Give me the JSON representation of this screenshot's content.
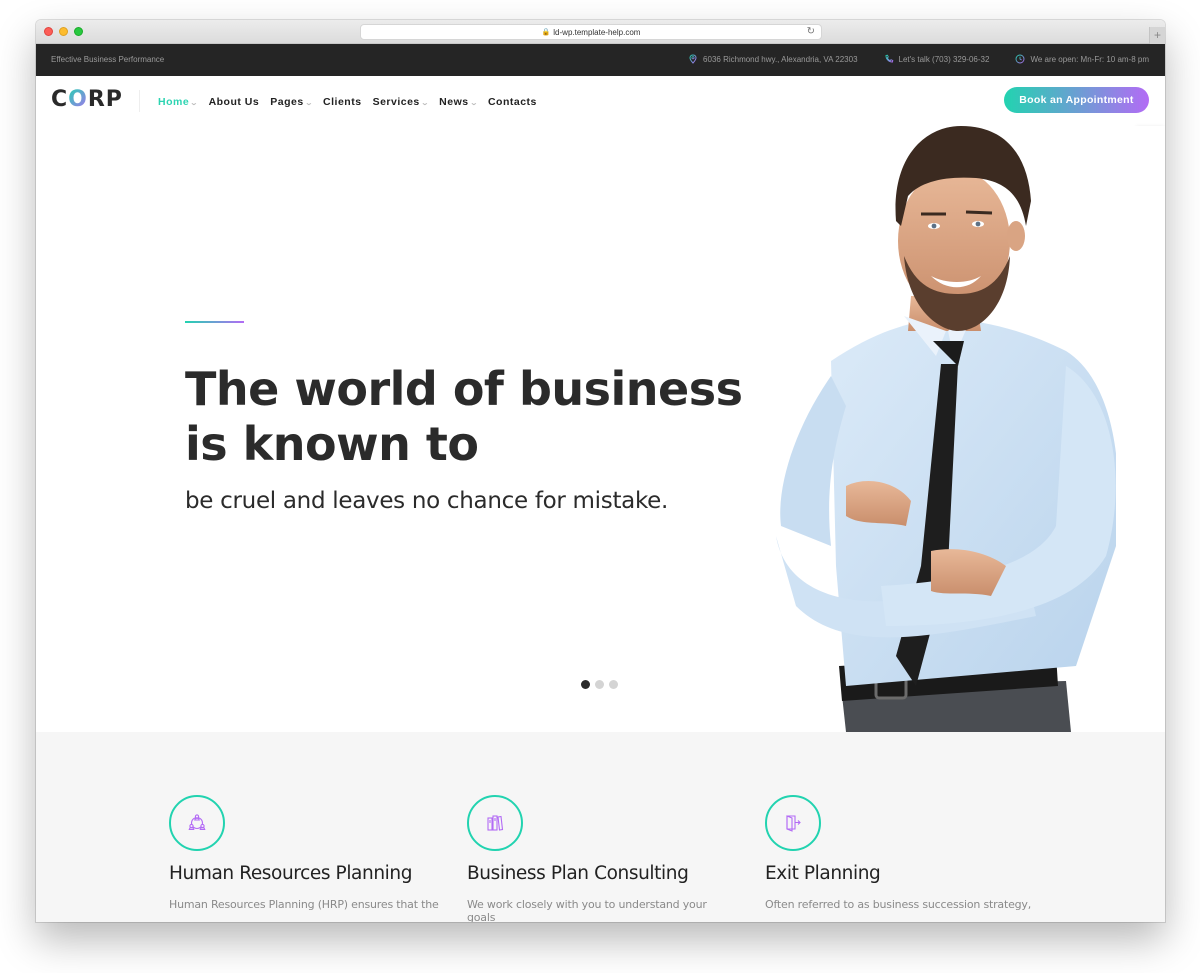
{
  "browser": {
    "url": "ld-wp.template-help.com",
    "traffic_lights": [
      "close",
      "minimize",
      "maximize"
    ]
  },
  "topbar": {
    "tagline": "Effective Business Performance",
    "address": "6036 Richmond hwy., Alexandria, VA 22303",
    "phone": "Let's talk (703) 329-06-32",
    "hours": "We are open: Mn-Fr: 10 am-8 pm"
  },
  "header": {
    "logo": {
      "pre": "C",
      "accent": "O",
      "post": "RP"
    },
    "nav": [
      {
        "label": "Home",
        "dropdown": true,
        "active": true
      },
      {
        "label": "About Us",
        "dropdown": false,
        "active": false
      },
      {
        "label": "Pages",
        "dropdown": true,
        "active": false
      },
      {
        "label": "Clients",
        "dropdown": false,
        "active": false
      },
      {
        "label": "Services",
        "dropdown": true,
        "active": false
      },
      {
        "label": "News",
        "dropdown": true,
        "active": false
      },
      {
        "label": "Contacts",
        "dropdown": false,
        "active": false
      }
    ],
    "cta_label": "Book an Appointment"
  },
  "hero": {
    "title_line1": "The world of business",
    "title_line2": "is known to",
    "subtitle": "be cruel and leaves no chance for mistake.",
    "slides_total": 3,
    "slide_active": 1
  },
  "services": [
    {
      "icon": "team-icon",
      "title": "Human Resources Planning",
      "desc": "Human Resources Planning (HRP) ensures that the"
    },
    {
      "icon": "books-icon",
      "title": "Business Plan Consulting",
      "desc": "We work closely with you to understand your goals"
    },
    {
      "icon": "exit-door-icon",
      "title": "Exit Planning",
      "desc": "Often referred to as business succession strategy,"
    }
  ],
  "colors": {
    "accent_teal": "#22d3b0",
    "accent_purple": "#b36bf5",
    "topbar_bg": "#252525",
    "services_bg": "#f6f6f6"
  }
}
